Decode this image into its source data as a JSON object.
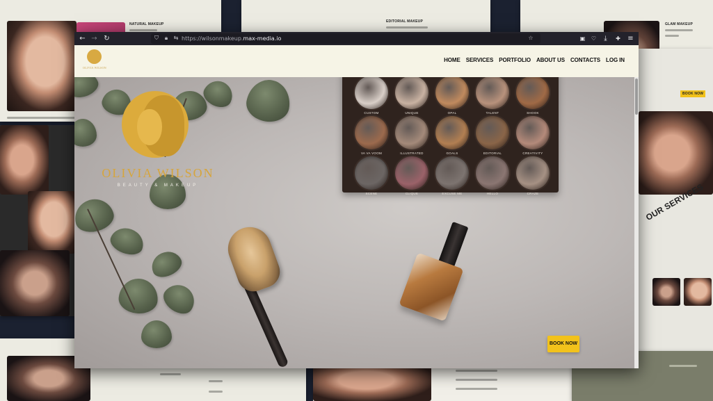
{
  "browser": {
    "url_prefix": "https://wilsonmakeup.",
    "url_domain": "max-media.io"
  },
  "site": {
    "logo_text": "OLIVIA WILSON",
    "nav": [
      "HOME",
      "SERVICES",
      "PORTFOLIO",
      "ABOUT US",
      "CONTACTS",
      "LOG IN"
    ],
    "hero": {
      "brand_name": "OLIVIA WILSON",
      "tagline": "BEAUTY & MAKEUP",
      "book_button": "BOOK NOW"
    },
    "palette_shades": [
      {
        "name": "CUSTOM",
        "color": "#d9cfc8"
      },
      {
        "name": "UNIQUE",
        "color": "#c9b2a2"
      },
      {
        "name": "OPAL",
        "color": "#c08a5e"
      },
      {
        "name": "TALENT",
        "color": "#b8927c"
      },
      {
        "name": "SHOOK",
        "color": "#a06a46"
      },
      {
        "name": "VA VA VOOM",
        "color": "#9c6a4d"
      },
      {
        "name": "ILLUSTRATED",
        "color": "#a48a7a"
      },
      {
        "name": "GOALS",
        "color": "#b27f52"
      },
      {
        "name": "EDITORIAL",
        "color": "#8a6548"
      },
      {
        "name": "CREATIVITY",
        "color": "#b48a7a"
      },
      {
        "name": "SCENE",
        "color": "#6c6664"
      },
      {
        "name": "CLIQUE",
        "color": "#9b6269"
      },
      {
        "name": "EXCUSE ME",
        "color": "#7d7470"
      },
      {
        "name": "HELLO",
        "color": "#8b7672"
      },
      {
        "name": "CRAZE",
        "color": "#a69184"
      }
    ]
  },
  "background": {
    "tile_labels": [
      "NATURAL MAKEUP",
      "EDITORIAL MAKEUP",
      "GLAM MAKEUP",
      "OUR SERVICES",
      "BOOK NOW"
    ]
  }
}
